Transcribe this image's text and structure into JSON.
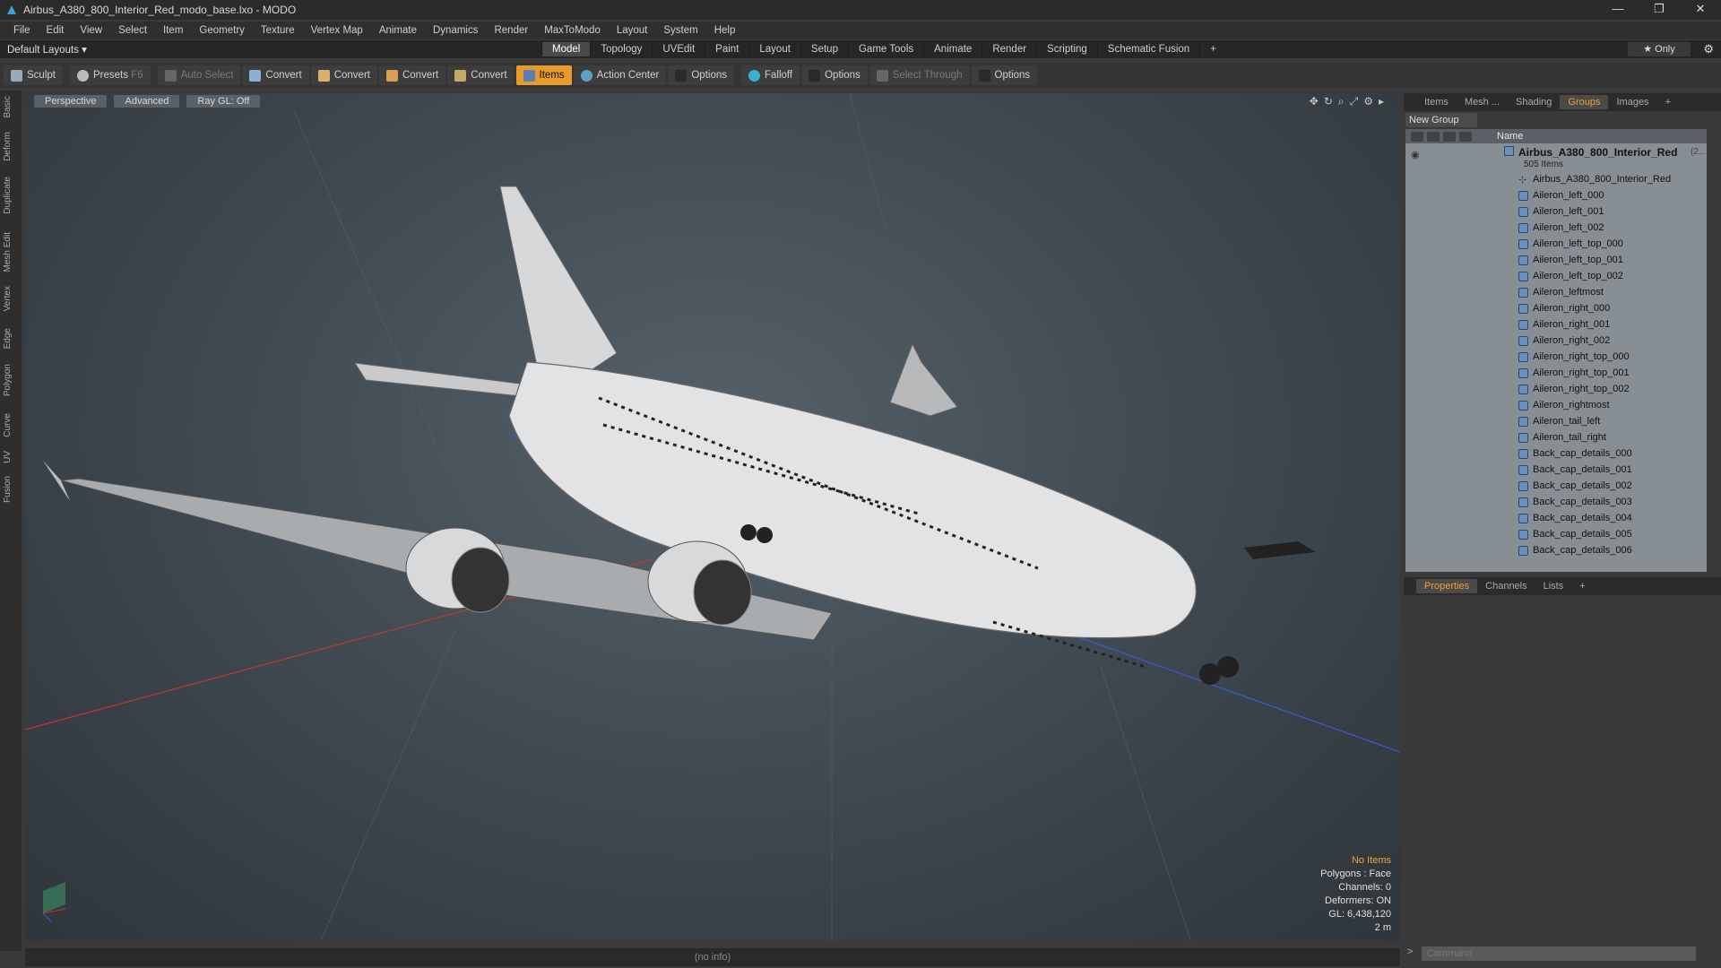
{
  "window": {
    "title": "Airbus_A380_800_Interior_Red_modo_base.lxo - MODO",
    "controls": [
      "—",
      "❐",
      "✕"
    ]
  },
  "menu": [
    "File",
    "Edit",
    "View",
    "Select",
    "Item",
    "Geometry",
    "Texture",
    "Vertex Map",
    "Animate",
    "Dynamics",
    "Render",
    "MaxToModo",
    "Layout",
    "System",
    "Help"
  ],
  "layout": {
    "name": "Default Layouts ▾",
    "tabs": [
      "Model",
      "Topology",
      "UVEdit",
      "Paint",
      "Layout",
      "Setup",
      "Game Tools",
      "Animate",
      "Render",
      "Scripting",
      "Schematic Fusion",
      "+"
    ],
    "active_tab": "Model",
    "only_label": "★  Only"
  },
  "toolbar": {
    "sculpt": "Sculpt",
    "presets": "Presets",
    "presets_key": "F6",
    "auto_select": "Auto Select",
    "convert1": "Convert",
    "convert2": "Convert",
    "convert3": "Convert",
    "convert4": "Convert",
    "items": "Items",
    "action_center": "Action Center",
    "options1": "Options",
    "falloff": "Falloff",
    "options2": "Options",
    "select_through": "Select Through",
    "options3": "Options"
  },
  "side_tabs": [
    "Basic",
    "Deform",
    "Duplicate",
    "Mesh Edit",
    "Vertex",
    "Edge",
    "Polygon",
    "Curve",
    "UV",
    "Fusion"
  ],
  "viewport": {
    "view": "Perspective",
    "mode": "Advanced",
    "render": "Ray GL: Off",
    "info": {
      "no_items": "No Items",
      "polygons": "Polygons : Face",
      "channels": "Channels: 0",
      "deformers": "Deformers: ON",
      "gl": "GL: 6,438,120",
      "scale": "2 m"
    },
    "status": "(no info)"
  },
  "right_panel": {
    "tabs": [
      "Items",
      "Mesh ...",
      "Shading",
      "Groups",
      "Images",
      "+"
    ],
    "active_tab": "Groups",
    "new_group": "New Group",
    "column_name": "Name",
    "root": {
      "name": "Airbus_A380_800_Interior_Red",
      "suffix": "(2...",
      "count": "505 Items"
    },
    "items": [
      "Airbus_A380_800_Interior_Red",
      "Aileron_left_000",
      "Aileron_left_001",
      "Aileron_left_002",
      "Aileron_left_top_000",
      "Aileron_left_top_001",
      "Aileron_left_top_002",
      "Aileron_leftmost",
      "Aileron_right_000",
      "Aileron_right_001",
      "Aileron_right_002",
      "Aileron_right_top_000",
      "Aileron_right_top_001",
      "Aileron_right_top_002",
      "Aileron_rightmost",
      "Aileron_tail_left",
      "Aileron_tail_right",
      "Back_cap_details_000",
      "Back_cap_details_001",
      "Back_cap_details_002",
      "Back_cap_details_003",
      "Back_cap_details_004",
      "Back_cap_details_005",
      "Back_cap_details_006"
    ],
    "props_tabs": [
      "Properties",
      "Channels",
      "Lists",
      "+"
    ],
    "props_active": "Properties",
    "command_placeholder": "Command"
  },
  "colors": {
    "accent": "#e89a2a",
    "viewport": "#3e474e",
    "axis_red": "#c0392b",
    "axis_blue": "#3a5bd0"
  }
}
